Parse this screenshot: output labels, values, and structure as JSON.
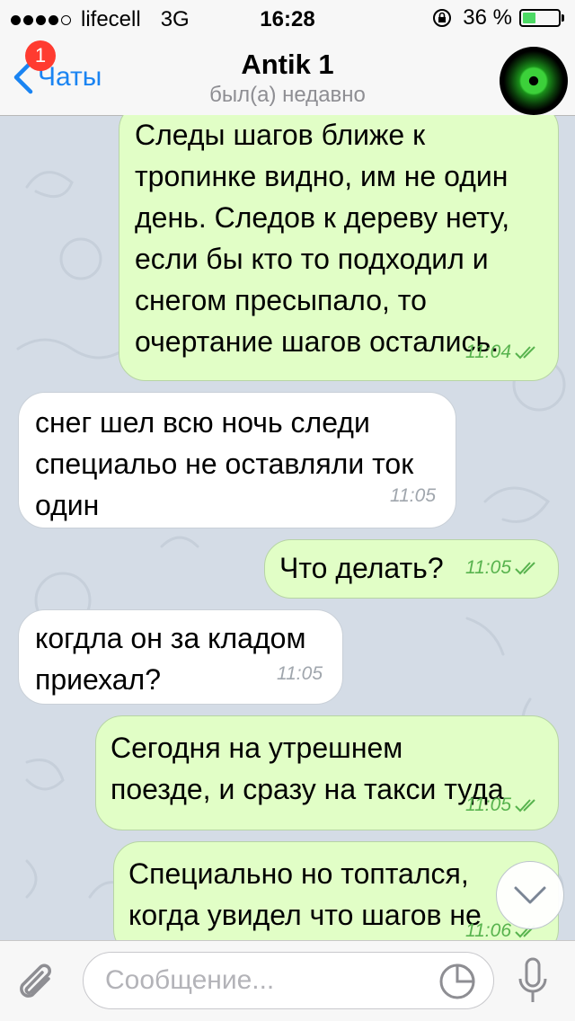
{
  "status_bar": {
    "carrier": "lifecell",
    "network": "3G",
    "time": "16:28",
    "battery": "36 %",
    "battery_level": 0.36,
    "signal_bars": 4
  },
  "header": {
    "back_label": "Чаты",
    "unread_badge": "1",
    "title": "Antik 1",
    "status": "был(а) недавно",
    "avatar_icon": "green-eye-avatar"
  },
  "messages": [
    {
      "dir": "out",
      "text": "Следы шагов ближе к\nтропинке видно, им не один\nдень. Следов к дереву нету,\nесли бы кто то подходил и\nснегом пресыпало, то\nочертание шагов остались.",
      "time": "11:04",
      "read": true
    },
    {
      "dir": "in",
      "text": "снег шел всю ночь следи\nспециальо не оставляли ток\nодин",
      "time": "11:05"
    },
    {
      "dir": "out",
      "text": "Что делать?",
      "time": "11:05",
      "read": true
    },
    {
      "dir": "in",
      "text": "когдла он за кладом\nприехал?",
      "time": "11:05"
    },
    {
      "dir": "out",
      "text": "Сегодня на утрешнем\nпоезде, и сразу на такси туда",
      "time": "11:05",
      "read": true
    },
    {
      "dir": "out",
      "text": "Специально но топтался,\nкогда увидел что шагов не",
      "time": "11:06",
      "read": true
    }
  ],
  "input": {
    "placeholder": "Сообщение..."
  },
  "colors": {
    "accent": "#1a84f2",
    "outgoing_bubble": "#e1fec6",
    "incoming_bubble": "#ffffff",
    "read_check": "#58b34e",
    "badge": "#ff3b30",
    "chat_background": "#d4dce6"
  }
}
